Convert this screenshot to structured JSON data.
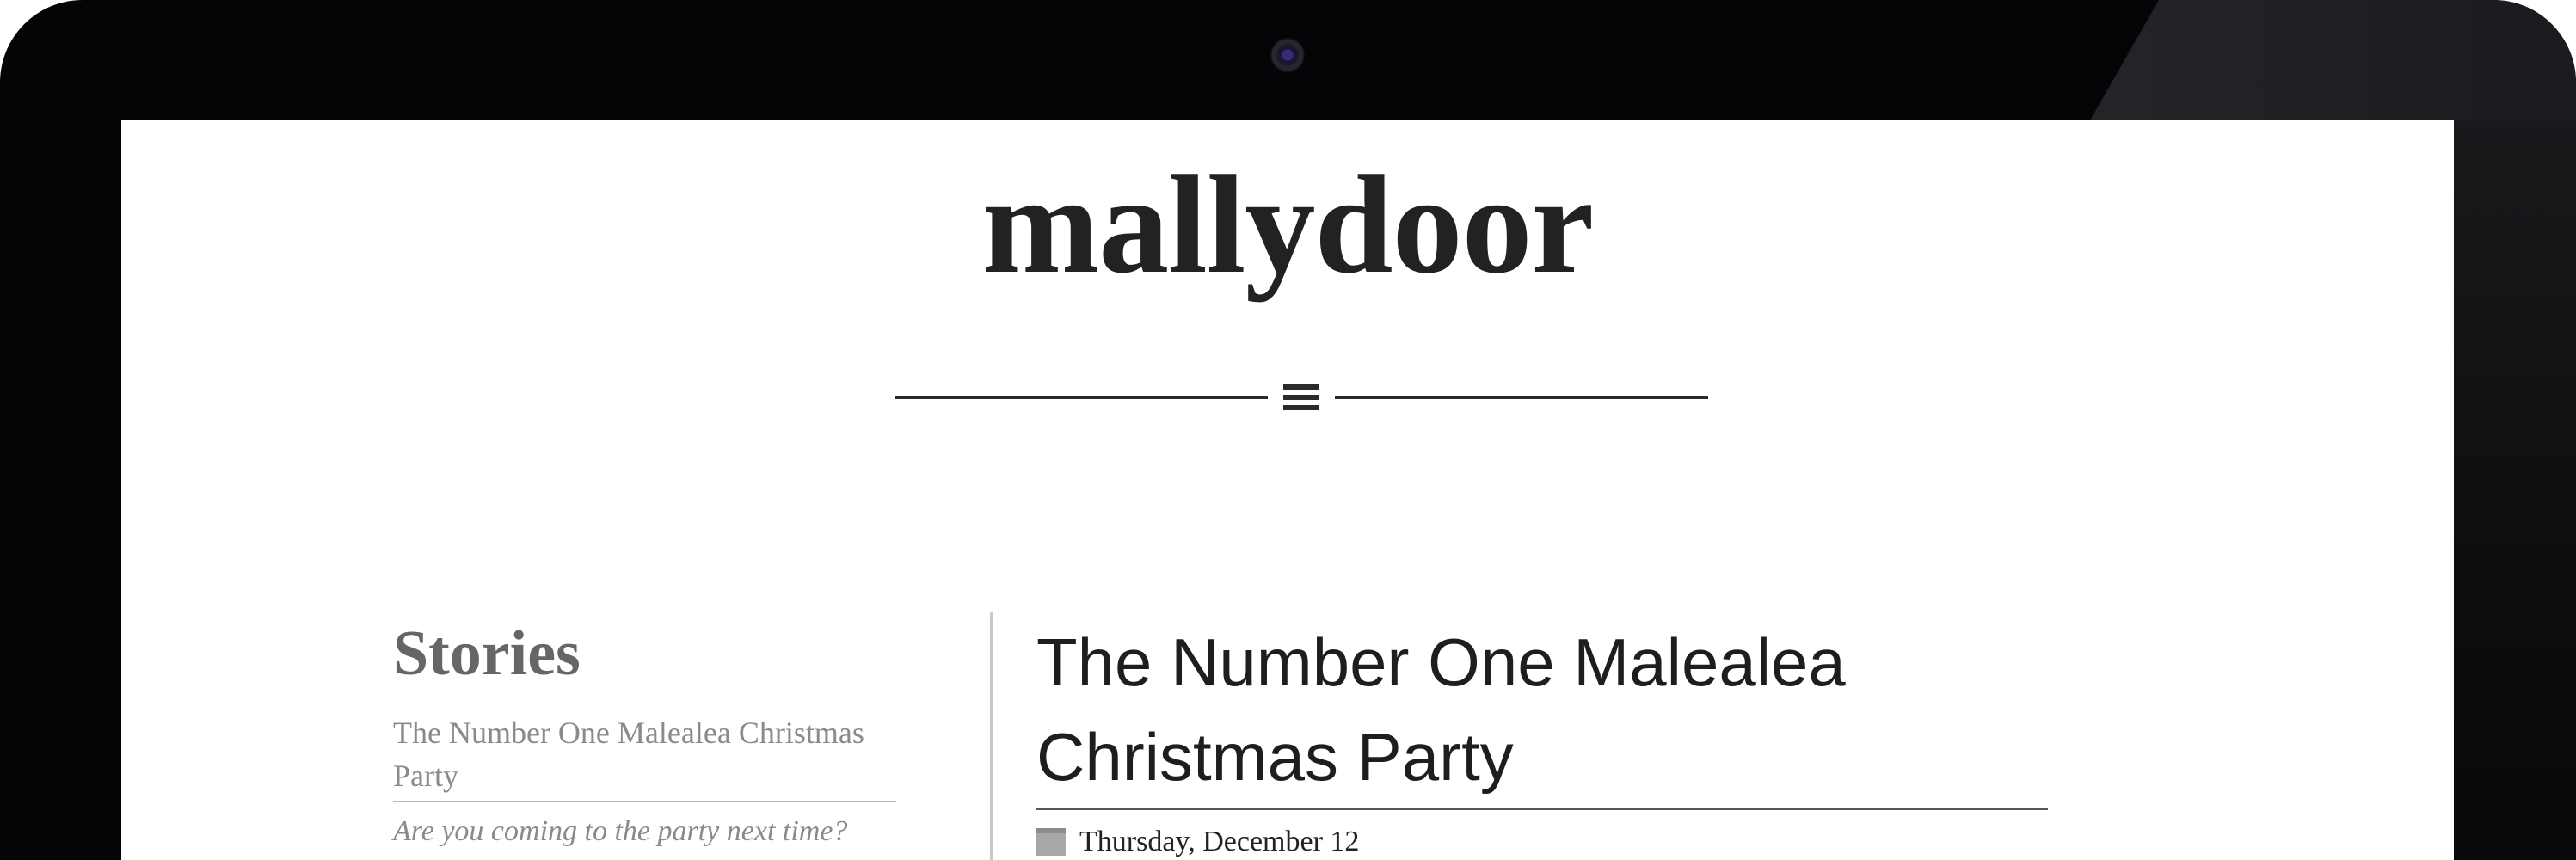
{
  "site": {
    "brand": "mallydoor",
    "menu_icon": "hamburger-menu-icon"
  },
  "sidebar": {
    "title": "Stories",
    "stories": [
      {
        "title": "The Number One Malealea Christmas Party",
        "tagline": "Are you coming to the party next time?"
      }
    ]
  },
  "article": {
    "title": "The Number One Malealea Christmas Party",
    "date": "Thursday, December 12",
    "date_icon": "calendar-icon"
  },
  "colors": {
    "bezel": "#050507",
    "screen_bg": "#ffffff",
    "text_dark": "#222222",
    "text_muted": "#8a8a8a"
  }
}
